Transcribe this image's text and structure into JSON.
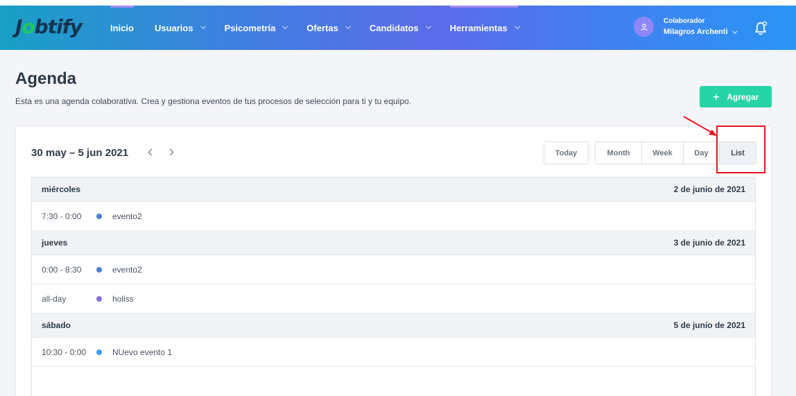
{
  "header": {
    "logo_text_pre": "J",
    "logo_text_o": "o",
    "logo_text_post": "btify",
    "nav": [
      {
        "label": "Inicio",
        "has_menu": false
      },
      {
        "label": "Usuarios",
        "has_menu": true
      },
      {
        "label": "Psicometría",
        "has_menu": true
      },
      {
        "label": "Ofertas",
        "has_menu": true
      },
      {
        "label": "Candidatos",
        "has_menu": true
      },
      {
        "label": "Herramientas",
        "has_menu": true
      }
    ],
    "user": {
      "role": "Colaborador",
      "name": "Milagros Archenti"
    },
    "icons": {
      "avatar": "user-icon",
      "notifications": "bell-icon"
    }
  },
  "page": {
    "title": "Agenda",
    "subtitle": "Esta es una agenda colaborativa. Crea y gestiona eventos de tus procesos de selección para ti y tu equipo.",
    "add_button": "Agregar",
    "add_icon": "+"
  },
  "calendar": {
    "range": "30 may – 5 jun 2021",
    "today_label": "Today",
    "views": [
      "Month",
      "Week",
      "Day",
      "List"
    ],
    "active_view": "List",
    "days": [
      {
        "name": "miércoles",
        "date": "2 de junio de 2021",
        "events": [
          {
            "time": "7:30 - 0:00",
            "title": "evento2",
            "color": "#4a7fd0"
          }
        ]
      },
      {
        "name": "jueves",
        "date": "3 de junio de 2021",
        "events": [
          {
            "time": "0:00 - 8:30",
            "title": "evento2",
            "color": "#4a7fd0"
          },
          {
            "time": "all-day",
            "title": "holiss",
            "color": "#8a6ed8"
          }
        ]
      },
      {
        "name": "sábado",
        "date": "5 de junio de 2021",
        "events": [
          {
            "time": "10:30 - 0:00",
            "title": "NUevo evento 1",
            "color": "#3e9bf2"
          }
        ]
      }
    ]
  },
  "colors": {
    "accent_green": "#26d4a5",
    "annotation_red": "#e8141c"
  }
}
